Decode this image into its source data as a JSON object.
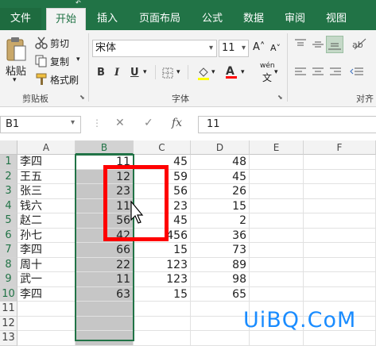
{
  "title_strip": {
    "quick_access": "↶"
  },
  "ribbon_tabs": [
    "文件",
    "开始",
    "插入",
    "页面布局",
    "公式",
    "数据",
    "审阅",
    "视图"
  ],
  "clipboard": {
    "paste": "粘贴",
    "cut": "剪切",
    "copy": "复制",
    "format_painter": "格式刷",
    "group_label": "剪贴板"
  },
  "font": {
    "name": "宋体",
    "size": "11",
    "bold": "B",
    "italic": "I",
    "underline": "U",
    "grow": "A˄",
    "shrink": "A˅",
    "font_color": "A",
    "phonetic": "wén",
    "group_label": "字体"
  },
  "alignment": {
    "group_label": "对齐"
  },
  "formula_bar": {
    "name_box": "B1",
    "cancel": "✕",
    "enter": "✓",
    "fx": "fx",
    "content": "11"
  },
  "columns": [
    "A",
    "B",
    "C",
    "D",
    "E",
    "F"
  ],
  "row_numbers": [
    "1",
    "2",
    "3",
    "4",
    "5",
    "6",
    "7",
    "8",
    "9",
    "10",
    "11",
    "12",
    "13"
  ],
  "rows": [
    {
      "a": "李四",
      "b": "11",
      "c": "45",
      "d": "48"
    },
    {
      "a": "王五",
      "b": "12",
      "c": "59",
      "d": "45"
    },
    {
      "a": "张三",
      "b": "23",
      "c": "56",
      "d": "26"
    },
    {
      "a": "钱六",
      "b": "11",
      "c": "23",
      "d": "15"
    },
    {
      "a": "赵二",
      "b": "56",
      "c": "45",
      "d": "2"
    },
    {
      "a": "孙七",
      "b": "42",
      "c": "456",
      "d": "36"
    },
    {
      "a": "李四",
      "b": "66",
      "c": "15",
      "d": "73"
    },
    {
      "a": "周十",
      "b": "22",
      "c": "123",
      "d": "89"
    },
    {
      "a": "武一",
      "b": "11",
      "c": "123",
      "d": "98"
    },
    {
      "a": "李四",
      "b": "63",
      "c": "15",
      "d": "65"
    },
    {
      "a": "",
      "b": "",
      "c": "",
      "d": ""
    },
    {
      "a": "",
      "b": "",
      "c": "",
      "d": ""
    },
    {
      "a": "",
      "b": "",
      "c": "",
      "d": ""
    }
  ],
  "watermark": "UiBQ.CoM",
  "colors": {
    "excel_green": "#217346",
    "selection": "#c6c6c6",
    "annotation_red": "#ff0000",
    "watermark": "#1a8cff"
  }
}
